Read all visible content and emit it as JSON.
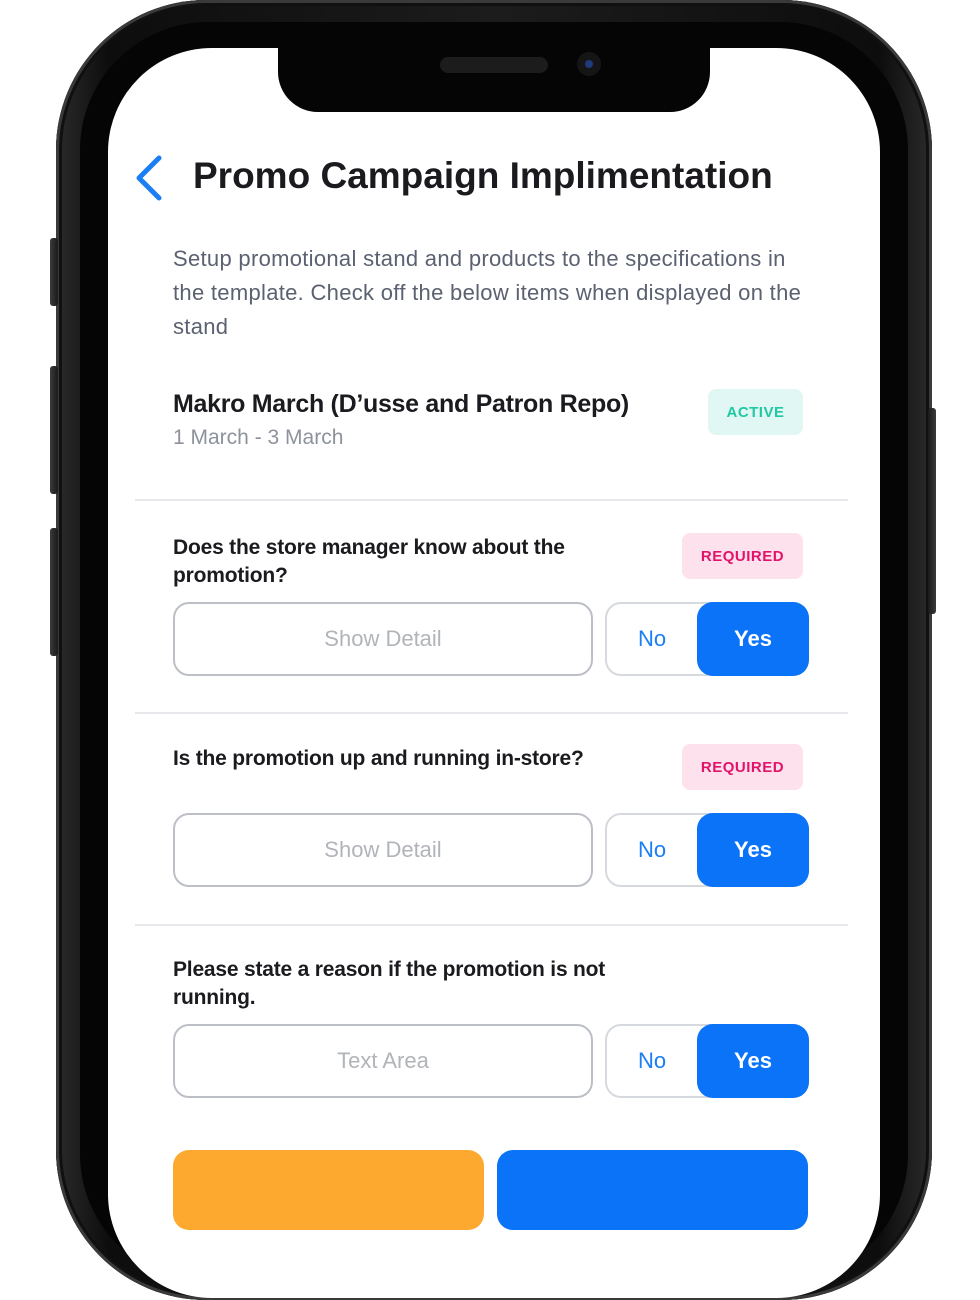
{
  "header": {
    "back_icon": "chevron-left-icon",
    "title": "Promo Campaign Implimentation"
  },
  "instructions": "Setup promotional stand and products to the specifications in the template. Check off the below items when displayed on the stand",
  "campaign": {
    "name": "Makro March (D’usse and Patron Repo)",
    "dates": "1 March - 3 March",
    "status": "ACTIVE"
  },
  "questions": [
    {
      "text": "Does the store manager know about the promotion?",
      "badge": "REQUIRED",
      "field_label": "Show Detail",
      "no_label": "No",
      "yes_label": "Yes",
      "selected": "Yes"
    },
    {
      "text": "Is the promotion up and running in-store?",
      "badge": "REQUIRED",
      "field_label": "Show Detail",
      "no_label": "No",
      "yes_label": "Yes",
      "selected": "Yes"
    },
    {
      "text": "Please state a reason if the promotion is not running.",
      "field_label": "Text Area",
      "no_label": "No",
      "yes_label": "Yes",
      "selected": "Yes"
    }
  ],
  "colors": {
    "primary_blue": "#0a73f7",
    "secondary_orange": "#fda930",
    "active_green": "#22c7a5",
    "required_pink": "#e3136b"
  }
}
